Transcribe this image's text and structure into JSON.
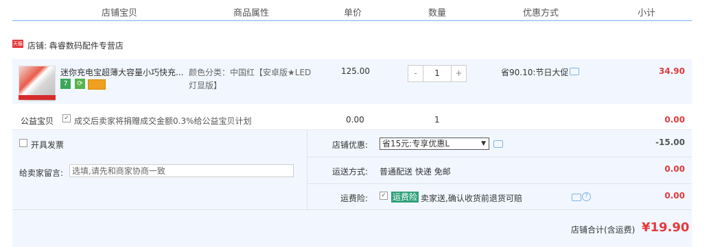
{
  "header": {
    "col_item": "店铺宝贝",
    "col_attr": "商品属性",
    "col_price": "单价",
    "col_qty": "数量",
    "col_discount": "优惠方式",
    "col_subtotal": "小计"
  },
  "shop": {
    "badge": "天猫",
    "name": "店铺: 犇睿数码配件专营店"
  },
  "item": {
    "title": "迷你充电宝超薄大容量小巧快充...",
    "attr": "颜色分类：中国红【安卓版★LED灯显版】",
    "price": "125.00",
    "qty": "1",
    "qty_minus": "-",
    "qty_plus": "+",
    "discount": "省90.10:节日大促",
    "subtotal": "34.90",
    "badges": [
      "7",
      "",
      ""
    ]
  },
  "charity": {
    "label": "公益宝贝",
    "text": "成交后卖家将捐赠成交金额0.3%给公益宝贝计划",
    "price": "0.00",
    "qty": "1",
    "subtotal": "0.00"
  },
  "invoice": {
    "label": "开具发票"
  },
  "message": {
    "label": "给卖家留言:",
    "placeholder": "选填,请先和商家协商一致"
  },
  "shop_discount": {
    "label": "店铺优惠:",
    "selected": "省15元:专享优惠L",
    "value": "-15.00"
  },
  "shipping": {
    "label": "运送方式:",
    "value": "普通配送 快递 免邮",
    "amount": "0.00"
  },
  "insurance": {
    "label": "运费险:",
    "tag": "运费险",
    "text": "卖家送,确认收货前退货可赔",
    "amount": "0.00"
  },
  "total": {
    "label": "店铺合计(含运费)",
    "value": "¥19.90"
  },
  "colors": {
    "accent_red": "#e4393c",
    "header_line": "#b2d1ff",
    "row_bg": "#f2f7ff",
    "green_tag": "#2fa07a"
  }
}
